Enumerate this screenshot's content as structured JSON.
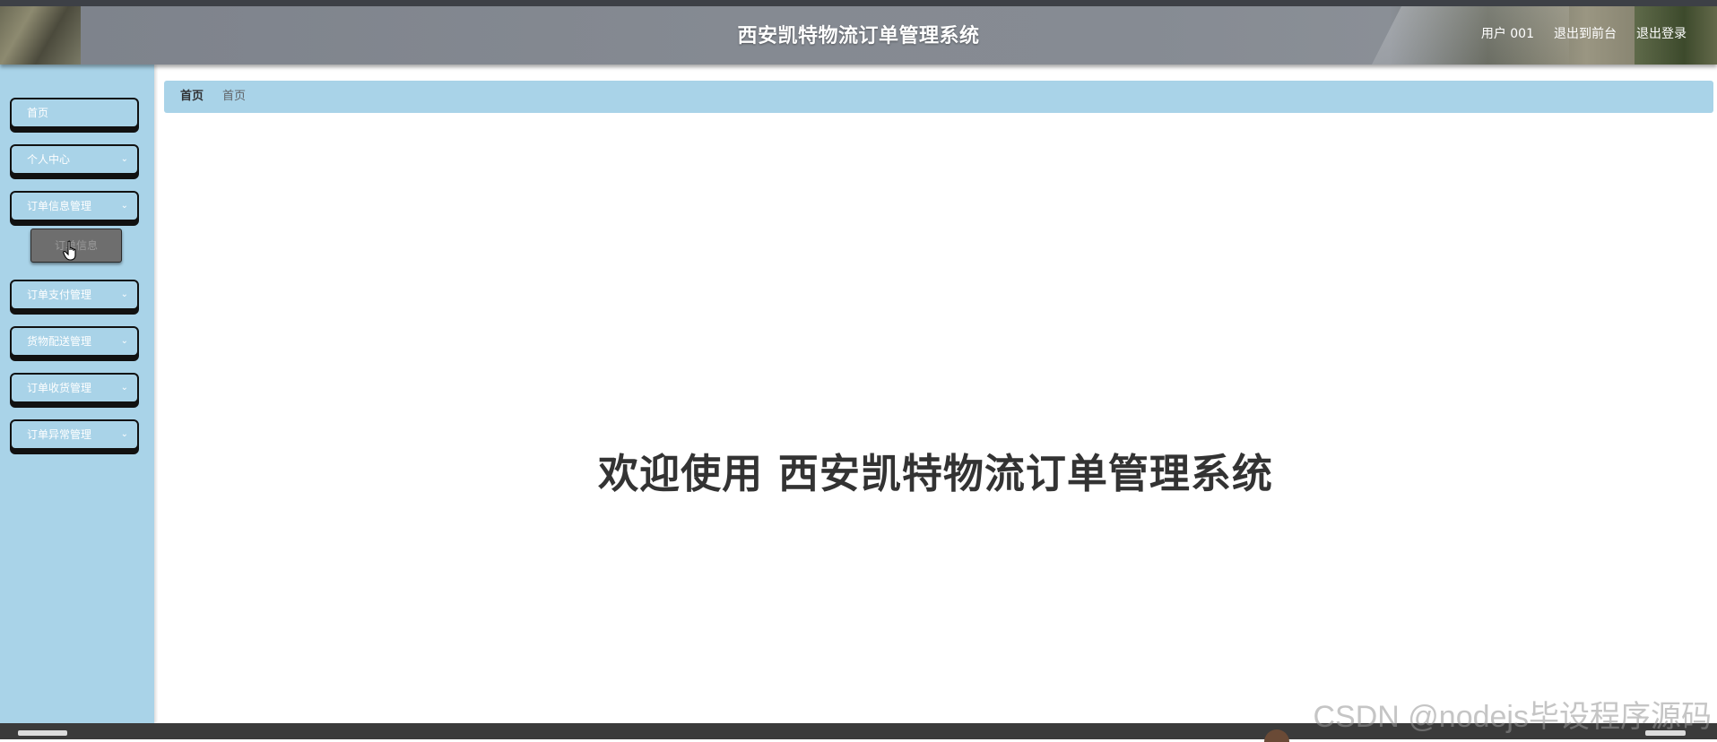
{
  "header": {
    "title": "西安凯特物流订单管理系统",
    "nav": [
      "用户 001",
      "退出到前台",
      "退出登录"
    ]
  },
  "sidebar": {
    "items": [
      {
        "label": "首页",
        "has_submenu": false
      },
      {
        "label": "个人中心",
        "has_submenu": true
      },
      {
        "label": "订单信息管理",
        "has_submenu": true,
        "expanded": true
      },
      {
        "label": "订单支付管理",
        "has_submenu": true
      },
      {
        "label": "货物配送管理",
        "has_submenu": true
      },
      {
        "label": "订单收货管理",
        "has_submenu": true
      },
      {
        "label": "订单异常管理",
        "has_submenu": true
      }
    ],
    "submenu": {
      "label": "订单信息"
    }
  },
  "breadcrumb": {
    "home": "首页",
    "current": "首页"
  },
  "main": {
    "welcome": "欢迎使用 西安凯特物流订单管理系统"
  },
  "watermark": "CSDN @nodejs毕设程序源码",
  "colors": {
    "accent": "#a9d3e8",
    "header_bg": "#858a92",
    "text": "#333333"
  }
}
